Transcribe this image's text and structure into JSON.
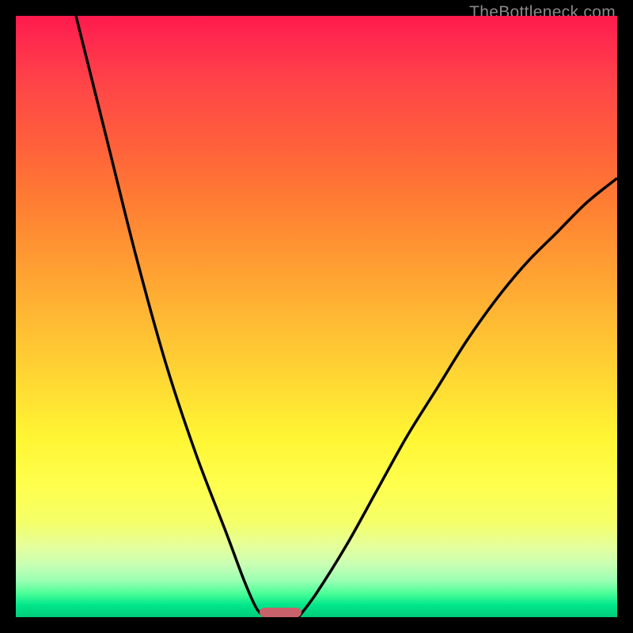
{
  "watermark": "TheBottleneck.com",
  "chart_data": {
    "type": "line",
    "title": "",
    "xlabel": "",
    "ylabel": "",
    "xlim": [
      0,
      100
    ],
    "ylim": [
      0,
      100
    ],
    "grid": false,
    "gradient_colors": {
      "top": "#ff1a4d",
      "mid": "#fff533",
      "bottom": "#00cc7a"
    },
    "series": [
      {
        "name": "left-curve",
        "x": [
          10,
          15,
          20,
          25,
          30,
          35,
          38,
          40,
          41.5
        ],
        "y": [
          100,
          80,
          60,
          42,
          27,
          14,
          6,
          1.5,
          0
        ]
      },
      {
        "name": "right-curve",
        "x": [
          47,
          50,
          55,
          60,
          65,
          70,
          75,
          80,
          85,
          90,
          95,
          100
        ],
        "y": [
          0,
          4,
          12,
          21,
          30,
          38,
          46,
          53,
          59,
          64,
          69,
          73
        ]
      }
    ],
    "marker": {
      "x_center": 44,
      "width_percent": 7,
      "y": 0,
      "color": "#c9616b"
    }
  }
}
